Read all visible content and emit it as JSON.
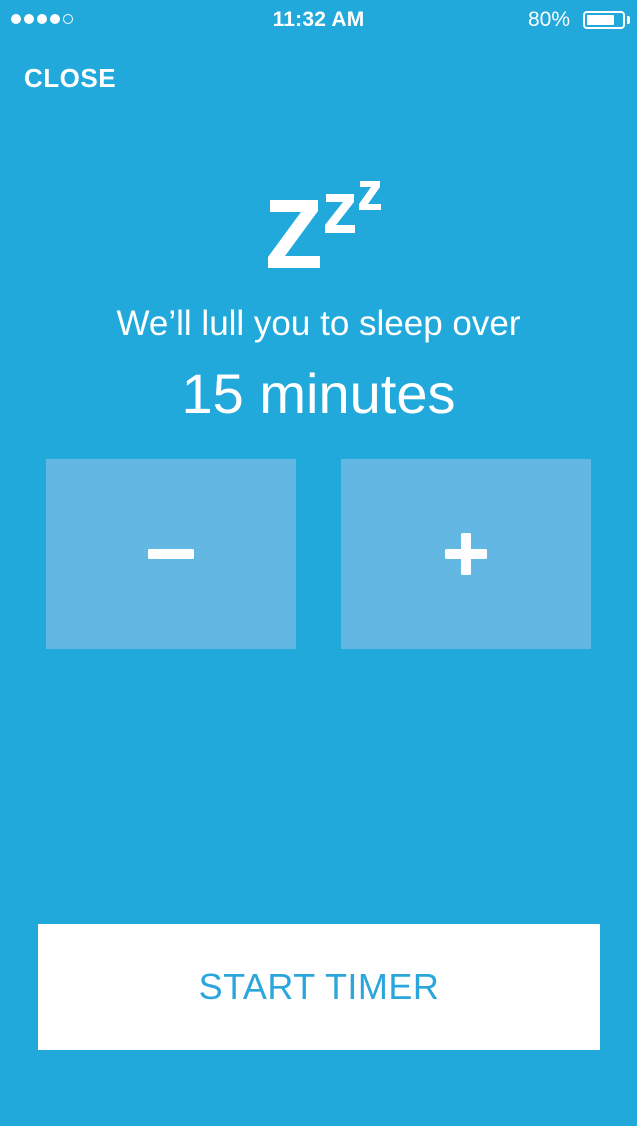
{
  "status_bar": {
    "signal_filled": 4,
    "signal_total": 5,
    "time": "11:32 AM",
    "battery_percent": "80%",
    "battery_level": 0.8
  },
  "header": {
    "close_label": "CLOSE"
  },
  "sleep": {
    "icon": "zzz-icon",
    "headline": "We’ll lull you to sleep over",
    "duration": "15 minutes"
  },
  "stepper": {
    "decrement_icon": "minus-icon",
    "increment_icon": "plus-icon"
  },
  "footer": {
    "start_label": "START TIMER"
  },
  "colors": {
    "background": "#22a9dc",
    "stepper_button": "#62b7e3",
    "primary_button_bg": "#ffffff",
    "primary_button_text": "#2aa6dc"
  }
}
